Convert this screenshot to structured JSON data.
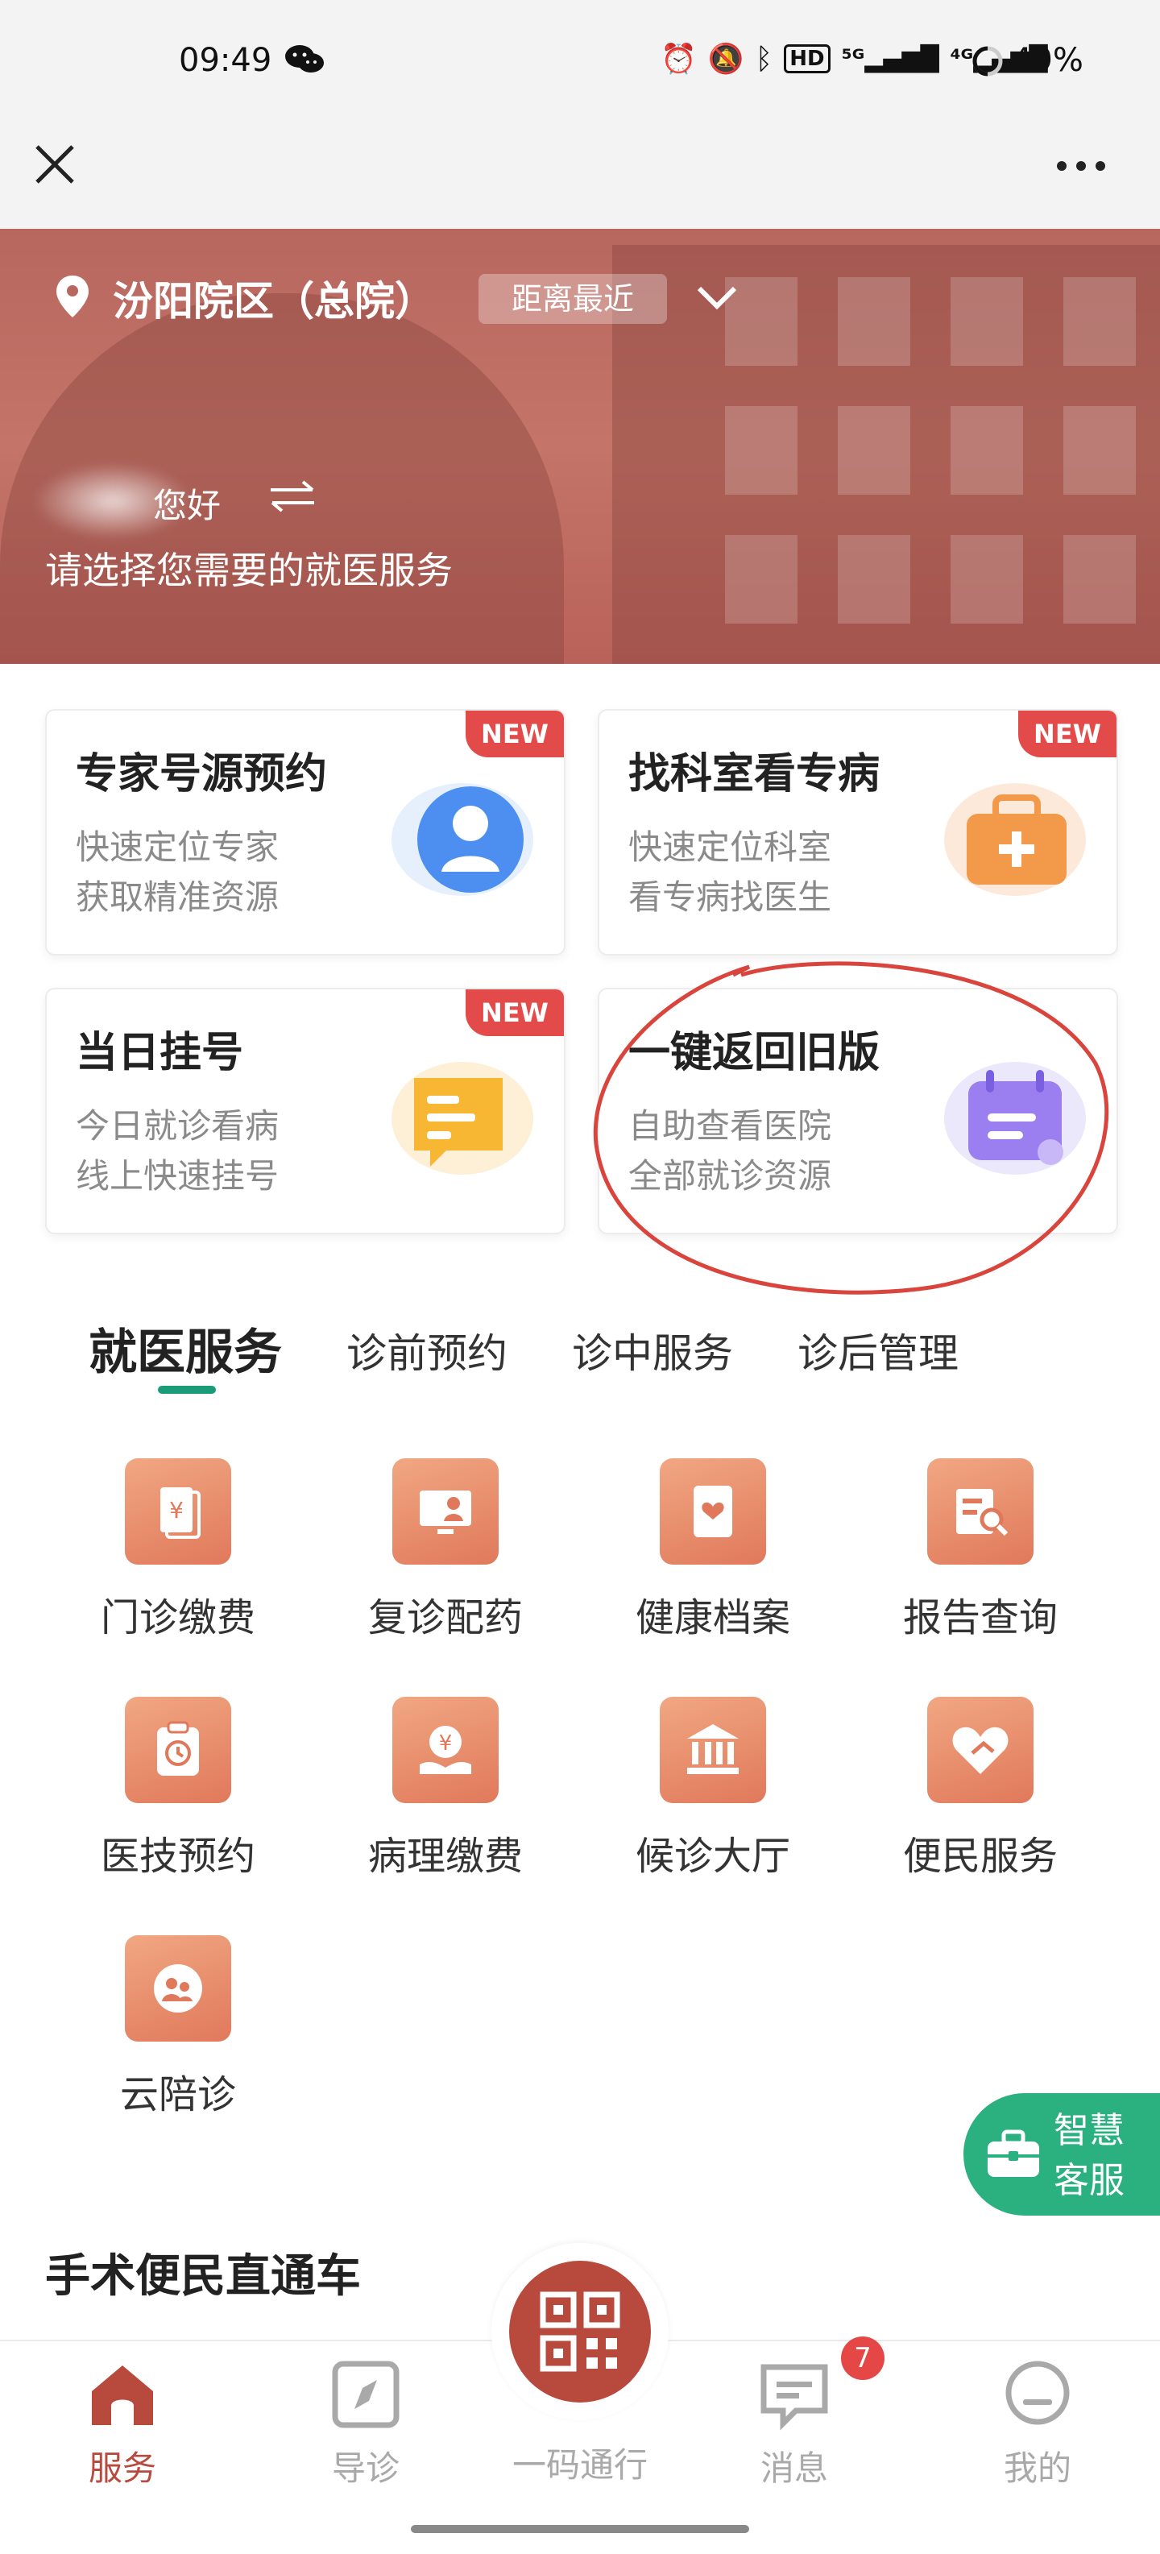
{
  "status_bar": {
    "time": "09:49",
    "icons": [
      "wechat-icon",
      "alarm-icon",
      "mute-icon",
      "bluetooth-icon",
      "hd-icon",
      "5g-signal-icon",
      "4g-signal-icon"
    ],
    "battery": "49%"
  },
  "hero": {
    "campus": "汾阳院区（总院）",
    "distance_badge": "距离最近",
    "greeting": "您好",
    "subtitle": "请选择您需要的就医服务"
  },
  "cards": [
    {
      "title": "专家号源预约",
      "line1": "快速定位专家",
      "line2": "获取精准资源",
      "badge": "NEW"
    },
    {
      "title": "找科室看专病",
      "line1": "快速定位科室",
      "line2": "看专病找医生",
      "badge": "NEW"
    },
    {
      "title": "当日挂号",
      "line1": "今日就诊看病",
      "line2": "线上快速挂号",
      "badge": "NEW"
    },
    {
      "title": "一键返回旧版",
      "line1": "自助查看医院",
      "line2": "全部就诊资源",
      "badge": ""
    }
  ],
  "tabs": [
    "就医服务",
    "诊前预约",
    "诊中服务",
    "诊后管理"
  ],
  "services": [
    "门诊缴费",
    "复诊配药",
    "健康档案",
    "报告查询",
    "医技预约",
    "病理缴费",
    "候诊大厅",
    "便民服务",
    "云陪诊"
  ],
  "assistant": {
    "label": "智慧客服"
  },
  "section_title": "手术便民直通车",
  "nav": [
    {
      "label": "服务"
    },
    {
      "label": "导诊"
    },
    {
      "label": "一码通行"
    },
    {
      "label": "消息",
      "badge": "7"
    },
    {
      "label": "我的"
    }
  ],
  "colors": {
    "brand": "#b8493d",
    "accent_green": "#1a9b7a",
    "badge_red": "#e34b4b",
    "service_orange": "#e0795b"
  }
}
